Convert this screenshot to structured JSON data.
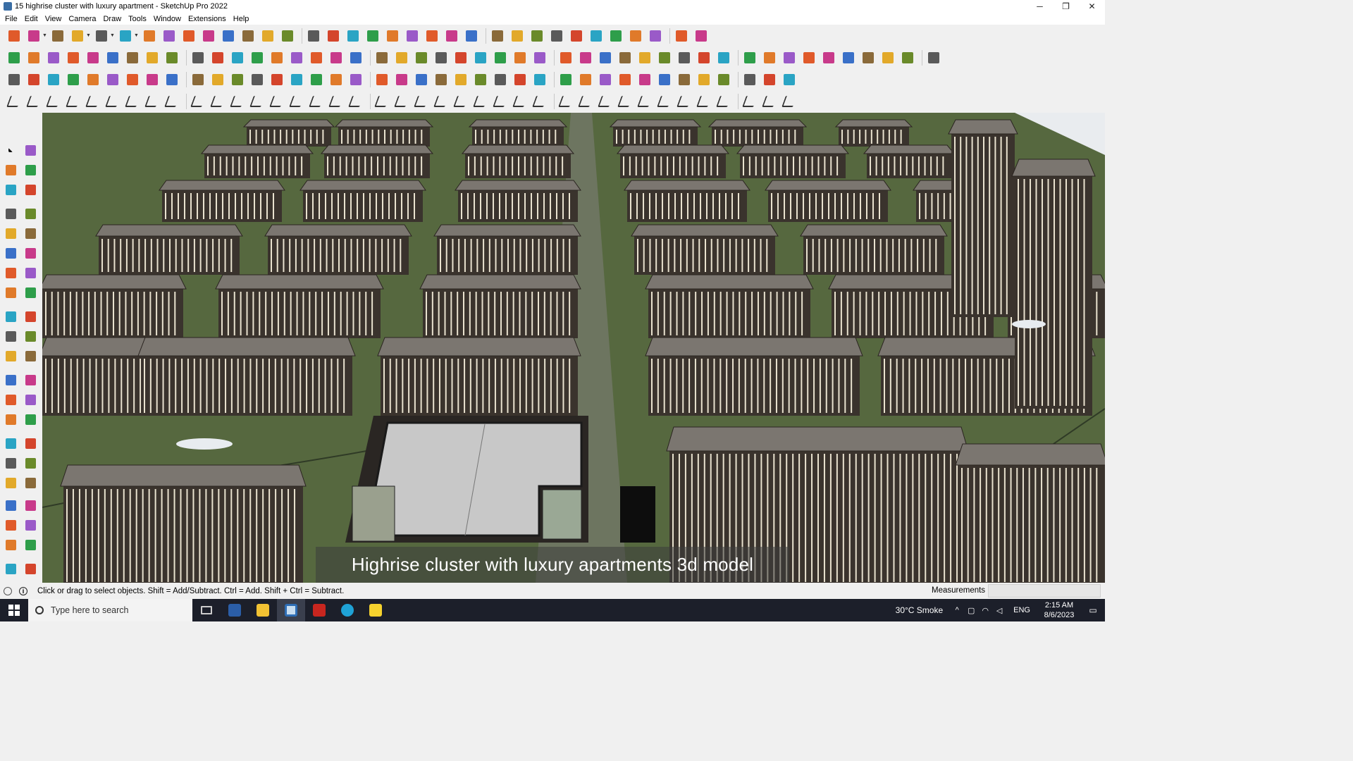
{
  "window": {
    "title": "15 highrise cluster with luxury apartment - SketchUp Pro 2022",
    "minimize": "─",
    "restore": "❐",
    "close": "✕"
  },
  "menu": [
    "File",
    "Edit",
    "View",
    "Camera",
    "Draw",
    "Tools",
    "Window",
    "Extensions",
    "Help"
  ],
  "caption": "Highrise cluster with luxury apartments 3d model",
  "status": {
    "hint": "Click or drag to select objects. Shift = Add/Subtract. Ctrl = Add. Shift + Ctrl = Subtract.",
    "info_glyph": "i",
    "measurements_label": "Measurements",
    "measurements_value": ""
  },
  "taskbar": {
    "search_placeholder": "Type here to search",
    "apps": [
      "task-view",
      "calculator",
      "file-explorer",
      "sketchup",
      "acrobat",
      "edge",
      "sticky-notes"
    ],
    "weather": "30°C  Smoke",
    "language": "ENG",
    "time": "2:15 AM",
    "date": "8/6/2023"
  },
  "colors": {
    "accent": "#0078d7",
    "grass": "#56683f",
    "building": "#3a332d",
    "roof": "#7b7670"
  }
}
